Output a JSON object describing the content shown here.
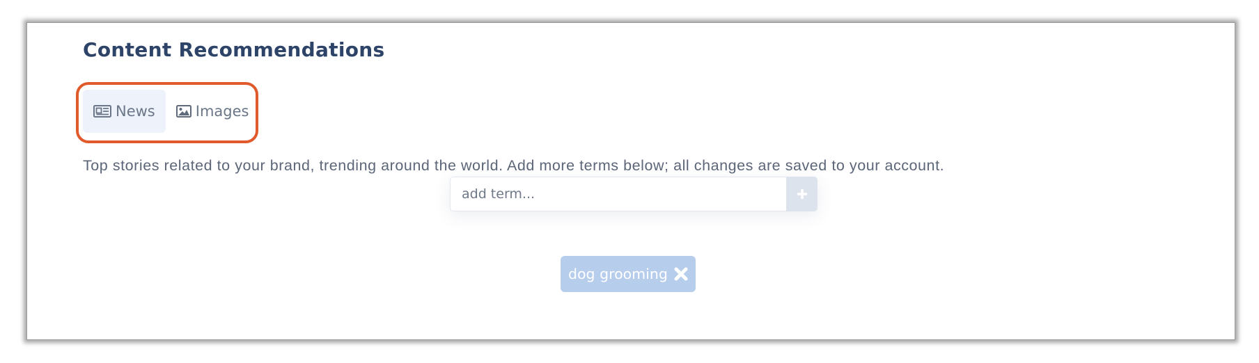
{
  "header": {
    "title": "Content Recommendations"
  },
  "tabs": [
    {
      "label": "News",
      "icon": "newspaper-icon",
      "active": true
    },
    {
      "label": "Images",
      "icon": "image-icon",
      "active": false
    }
  ],
  "description": "Top stories related to your brand, trending around the world. Add more terms below; all changes are saved to your account.",
  "term_input": {
    "value": "",
    "placeholder": "add term...",
    "add_button_icon": "plus-icon"
  },
  "terms": [
    {
      "label": "dog grooming",
      "remove_icon": "x-icon"
    }
  ],
  "colors": {
    "title": "#2d4468",
    "highlight": "#e15a2c",
    "active_tab_bg": "#eef2fa",
    "chip_bg": "#b7cdec",
    "add_button_bg": "#dde3ec"
  }
}
